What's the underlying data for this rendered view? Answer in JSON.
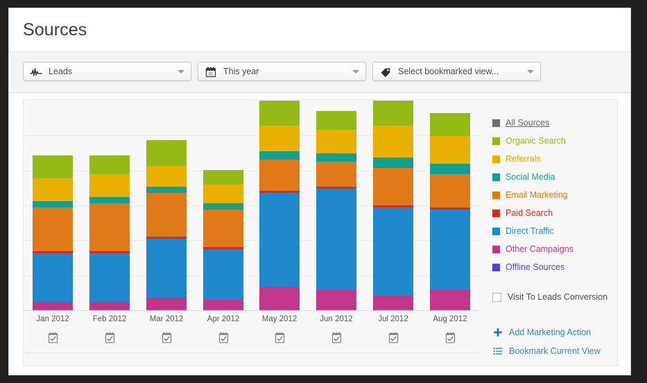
{
  "header": {
    "title": "Sources"
  },
  "toolbar": {
    "metric": {
      "label": "Leads",
      "icon": "sparkline-icon"
    },
    "period": {
      "label": "This year",
      "icon": "calendar-icon"
    },
    "bookmark": {
      "label": "Select bookmarked view...",
      "icon": "tag-icon"
    }
  },
  "legend": {
    "items": [
      {
        "label": "All Sources",
        "color": "#6e6e6e",
        "text_color": "#666666"
      },
      {
        "label": "Organic Search",
        "color": "#94b815",
        "text_color": "#94b815"
      },
      {
        "label": "Referrals",
        "color": "#e8b000",
        "text_color": "#d9a400"
      },
      {
        "label": "Social Media",
        "color": "#14a090",
        "text_color": "#14a090"
      },
      {
        "label": "Email Marketing",
        "color": "#e07a18",
        "text_color": "#e07a18"
      },
      {
        "label": "Paid Search",
        "color": "#d92b1c",
        "text_color": "#d92b1c"
      },
      {
        "label": "Direct Traffic",
        "color": "#2089ce",
        "text_color": "#2089ce"
      },
      {
        "label": "Other Campaigns",
        "color": "#c2368a",
        "text_color": "#c2368a"
      },
      {
        "label": "Offline Sources",
        "color": "#5b3fd4",
        "text_color": "#5b3fd4"
      }
    ]
  },
  "conversion": {
    "label": "Visit To Leads Conversion",
    "checked": false
  },
  "actions": [
    {
      "label": "Add Marketing Action",
      "icon": "plus-icon"
    },
    {
      "label": "Bookmark Current View",
      "icon": "list-icon"
    }
  ],
  "chart_data": {
    "type": "bar",
    "stacked": true,
    "title": "Sources",
    "xlabel": "",
    "ylabel": "",
    "grid": true,
    "gridline_count": 5,
    "legend_position": "right",
    "ylim": [
      0,
      100
    ],
    "categories": [
      "Jan 2012",
      "Feb 2012",
      "Mar 2012",
      "Apr 2012",
      "May 2012",
      "Jun 2012",
      "Jul 2012",
      "Aug 2012"
    ],
    "series": [
      {
        "name": "Other Campaigns",
        "color": "#c2368a",
        "values": [
          4,
          4,
          6,
          5,
          11,
          10,
          7,
          10
        ]
      },
      {
        "name": "Direct Traffic",
        "color": "#2089ce",
        "values": [
          23,
          23,
          28,
          24,
          45,
          48,
          42,
          38
        ]
      },
      {
        "name": "Paid Search",
        "color": "#d92b1c",
        "values": [
          1,
          1,
          1,
          1,
          1,
          1,
          1,
          1
        ]
      },
      {
        "name": "Email Marketing",
        "color": "#e07a18",
        "values": [
          21,
          23,
          21,
          18,
          15,
          12,
          18,
          16
        ]
      },
      {
        "name": "Social Media",
        "color": "#14a090",
        "values": [
          3,
          3,
          3,
          3,
          4,
          4,
          5,
          5
        ]
      },
      {
        "name": "Referrals",
        "color": "#e8b000",
        "values": [
          11,
          11,
          10,
          9,
          12,
          11,
          15,
          13
        ]
      },
      {
        "name": "Organic Search",
        "color": "#94b815",
        "values": [
          11,
          9,
          12,
          7,
          12,
          9,
          12,
          11
        ]
      }
    ]
  },
  "calendar_icon_name": "calendar-check-icon"
}
